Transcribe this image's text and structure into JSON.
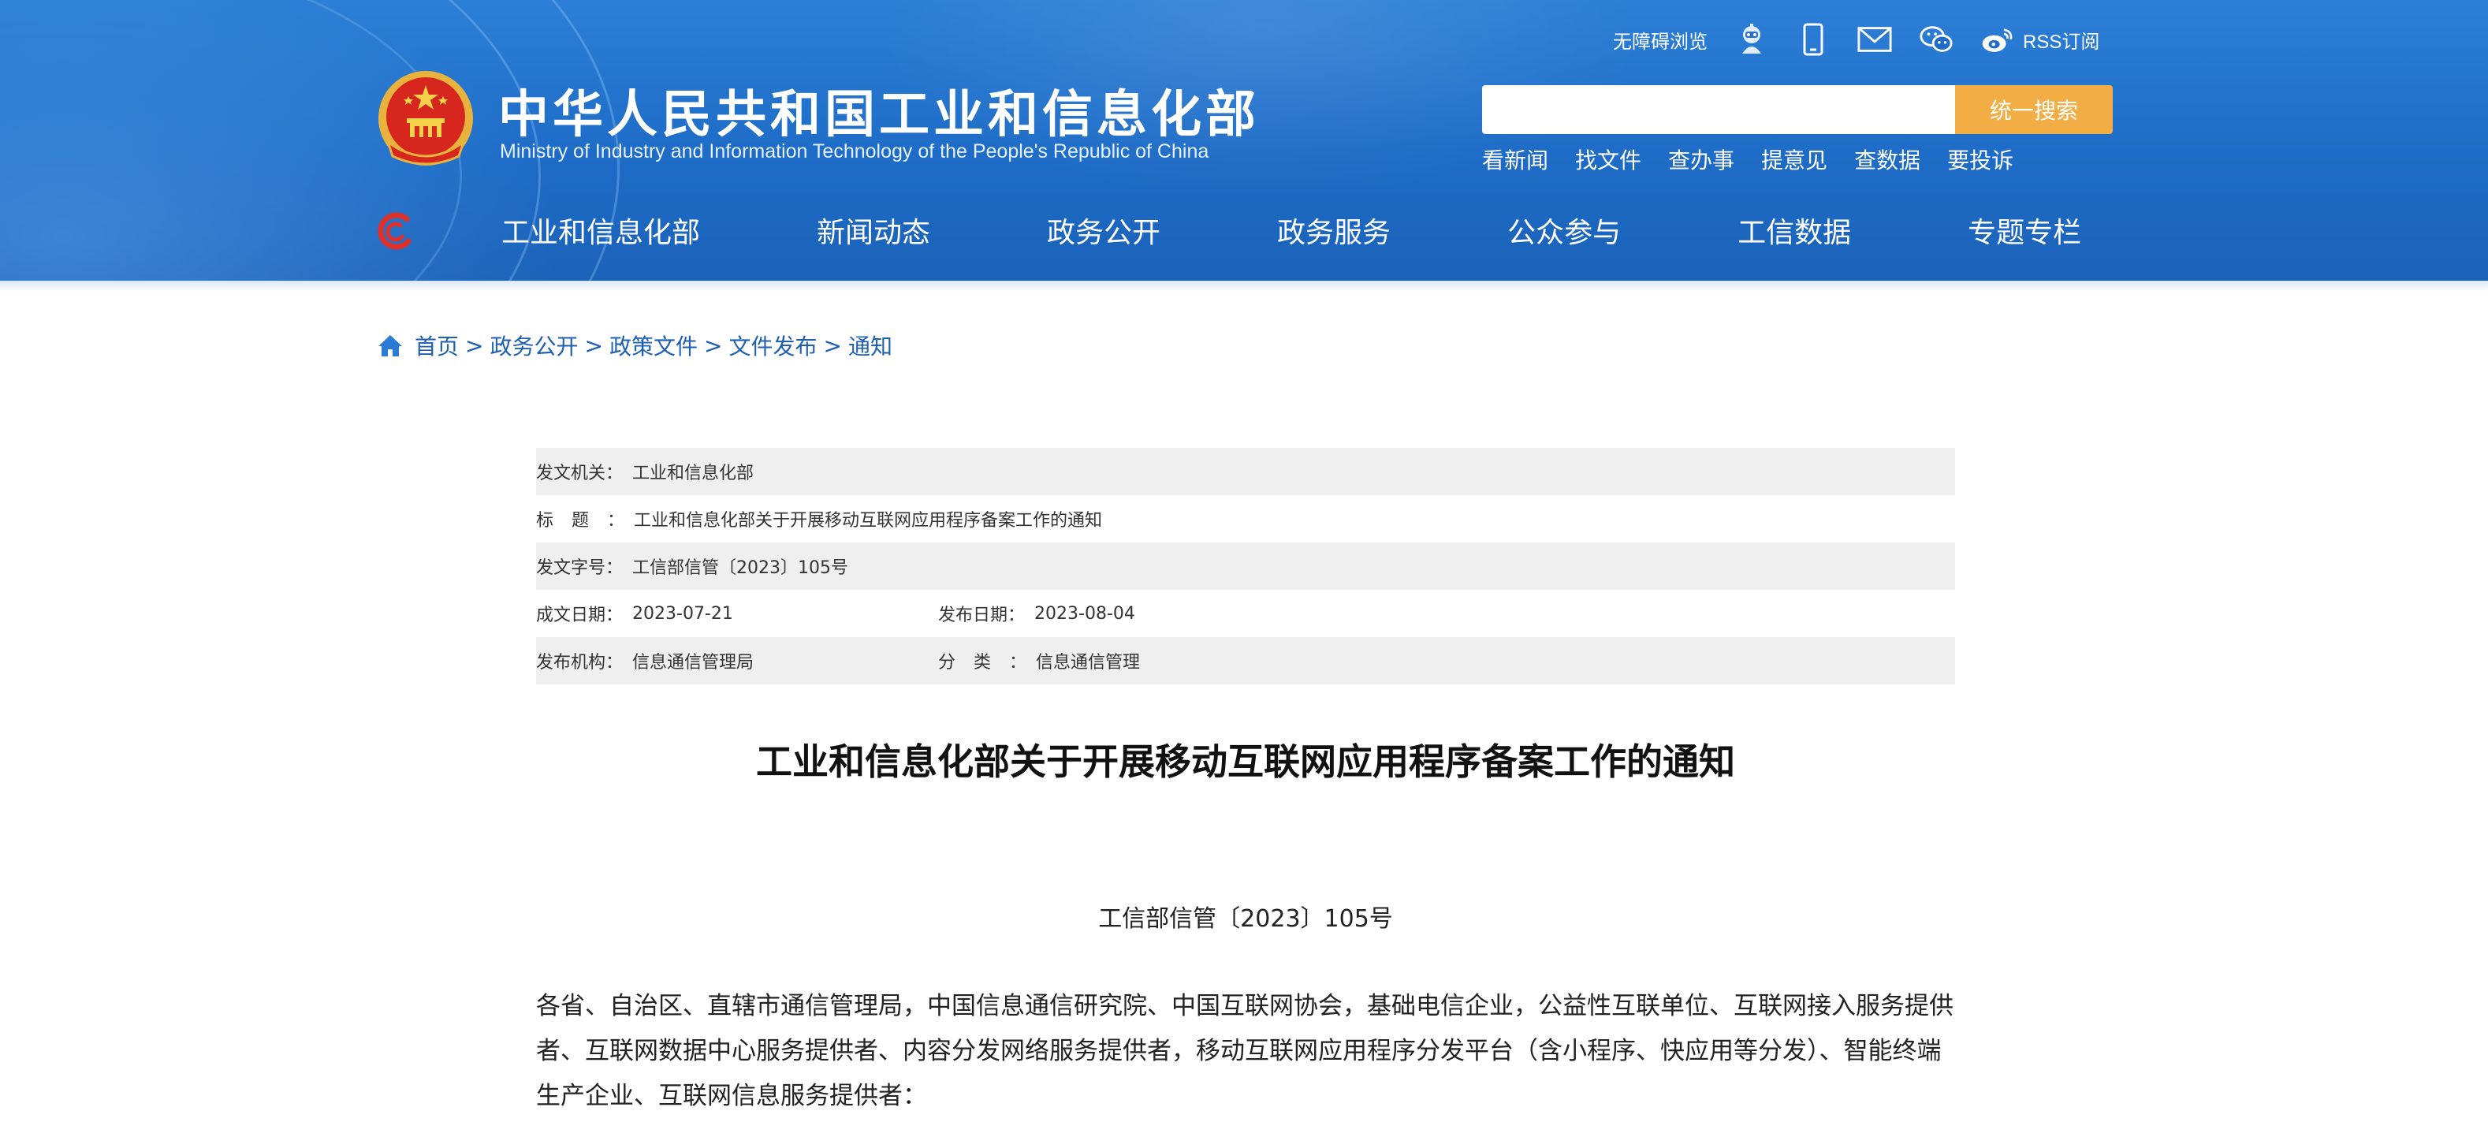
{
  "header": {
    "title": "中华人民共和国工业和信息化部",
    "subtitle": "Ministry of Industry and Information Technology of the People's Republic of China",
    "accessibility_link": "无障碍浏览",
    "rss_link": "RSS订阅",
    "icons": [
      "robot-assistant-icon",
      "mobile-phone-icon",
      "mail-icon",
      "wechat-icon",
      "weibo-icon"
    ],
    "search": {
      "placeholder": "",
      "button_label": "统一搜索"
    },
    "quick_links": [
      "看新闻",
      "找文件",
      "查办事",
      "提意见",
      "查数据",
      "要投诉"
    ],
    "nav": [
      "工业和信息化部",
      "新闻动态",
      "政务公开",
      "政务服务",
      "公众参与",
      "工信数据",
      "专题专栏"
    ],
    "colors": {
      "header_blue": "#1e6cc7",
      "search_button": "#f2ae45",
      "link_blue": "#1d5fb3"
    }
  },
  "breadcrumb": {
    "items": [
      "首页",
      "政务公开",
      "政策文件",
      "文件发布",
      "通知"
    ],
    "separator": ">"
  },
  "meta": {
    "issuer_label": "发文机关：",
    "issuer": "工业和信息化部",
    "title_label_a": "标",
    "title_label_b": "题：",
    "title": "工业和信息化部关于开展移动互联网应用程序备案工作的通知",
    "doc_no_label": "发文字号：",
    "doc_no": "工信部信管〔2023〕105号",
    "written_date_label": "成文日期：",
    "written_date": "2023-07-21",
    "publish_date_label": "发布日期：",
    "publish_date": "2023-08-04",
    "org_label": "发布机构：",
    "org": "信息通信管理局",
    "category_label_a": "分",
    "category_label_b": "类：",
    "category": "信息通信管理"
  },
  "article": {
    "title": "工业和信息化部关于开展移动互联网应用程序备案工作的通知",
    "doc_number": "工信部信管〔2023〕105号",
    "paragraph1": "各省、自治区、直辖市通信管理局，中国信息通信研究院、中国互联网协会，基础电信企业，公益性互联单位、互联网接入服务提供者、互联网数据中心服务提供者、内容分发网络服务提供者，移动互联网应用程序分发平台（含小程序、快应用等分发）、智能终端生产企业、互联网信息服务提供者："
  }
}
